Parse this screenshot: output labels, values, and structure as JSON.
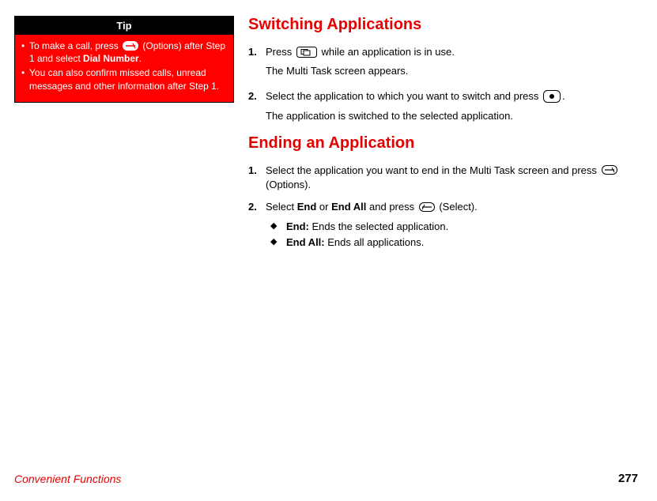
{
  "tip": {
    "title": "Tip",
    "items": [
      {
        "pre": "To make a call, press ",
        "post": " (Options) after Step 1 and select ",
        "bold": "Dial Number",
        "end": "."
      },
      {
        "text": "You can also confirm missed calls, unread messages and other information after Step 1."
      }
    ]
  },
  "sections": {
    "switching": {
      "heading": "Switching Applications",
      "steps": [
        {
          "num": "1.",
          "pre": "Press ",
          "post": " while an application is in use.",
          "sub": "The Multi Task screen appears."
        },
        {
          "num": "2.",
          "pre": "Select the application to which you want to switch and press ",
          "post": ".",
          "sub": "The application is switched to the selected application."
        }
      ]
    },
    "ending": {
      "heading": "Ending an Application",
      "steps": [
        {
          "num": "1.",
          "pre": "Select the application you want to end in the Multi Task screen and press ",
          "post": " (Options)."
        },
        {
          "num": "2.",
          "preA": "Select ",
          "b1": "End",
          "mid": " or ",
          "b2": "End All",
          "preB": " and press ",
          "post": " (Select)."
        }
      ],
      "bullets": [
        {
          "label": "End:",
          "text": " Ends the selected application."
        },
        {
          "label": "End All:",
          "text": " Ends all applications."
        }
      ]
    }
  },
  "footer": {
    "section": "Convenient Functions",
    "page": "277"
  }
}
